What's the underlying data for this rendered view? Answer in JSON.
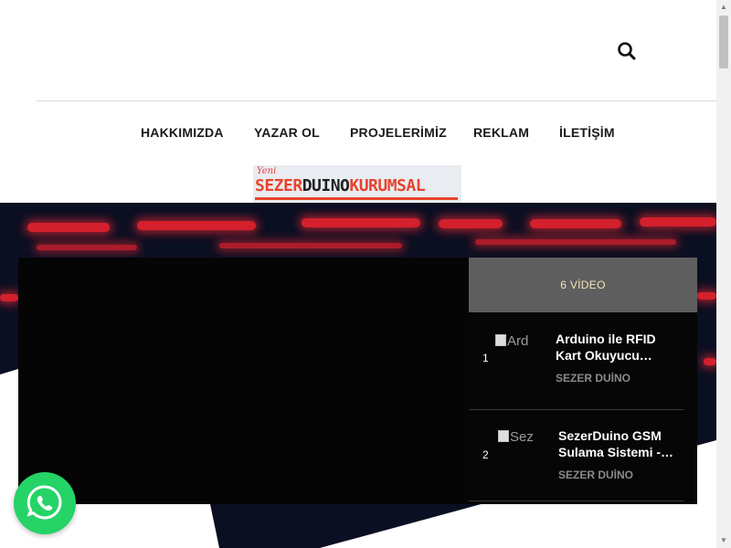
{
  "header": {
    "search_icon": "search-icon"
  },
  "nav": {
    "items": [
      {
        "label": "HAKKIMIZDA"
      },
      {
        "label": "YAZAR OL"
      },
      {
        "label": "PROJELERİMİZ"
      },
      {
        "label": "REKLAM"
      },
      {
        "label": "İLETİŞİM"
      }
    ]
  },
  "brand": {
    "prefix": "Yeni",
    "word_1": "SEZER",
    "word_2": "DUINO",
    "word_3": "KURUMSAL"
  },
  "playlist": {
    "count_label": "6 VİDEO",
    "items": [
      {
        "number": "1",
        "thumb_alt": "Ard",
        "title": "Arduino ile RFID Kart Okuyucu…",
        "author": "SEZER DUİNO"
      },
      {
        "number": "2",
        "thumb_alt": "Sez",
        "title": "SezerDuino GSM Sulama Sistemi -…",
        "author": "SEZER DUİNO"
      }
    ]
  },
  "colors": {
    "accent": "#e8442f",
    "playlist_header": "#5e5e5e",
    "playlist_count": "#f4e3b8",
    "whatsapp": "#25d366"
  },
  "floating": {
    "whatsapp_icon": "whatsapp-icon"
  }
}
